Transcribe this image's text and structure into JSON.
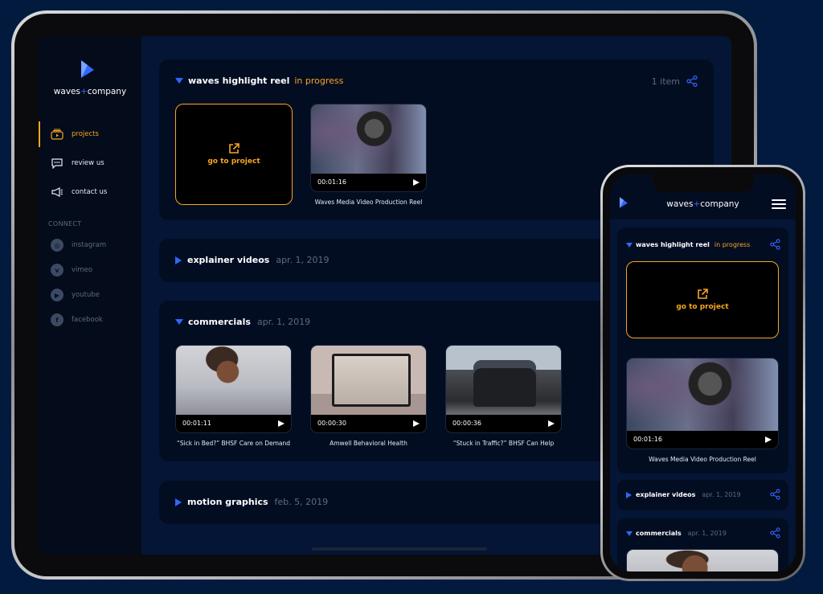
{
  "brand": {
    "name_left": "waves",
    "plus": "+",
    "name_right": "company"
  },
  "colors": {
    "accent": "#f5a623",
    "blue": "#2f67ff",
    "bg": "#031a3f",
    "panel": "#030d22"
  },
  "tablet": {
    "nav": [
      {
        "label": "projects",
        "icon": "projects-icon",
        "active": true
      },
      {
        "label": "review us",
        "icon": "chat-icon",
        "active": false
      },
      {
        "label": "contact us",
        "icon": "megaphone-icon",
        "active": false
      }
    ],
    "connect_label": "CONNECT",
    "social": [
      {
        "label": "instagram",
        "icon": "instagram-icon",
        "glyph": "◎"
      },
      {
        "label": "vimeo",
        "icon": "vimeo-icon",
        "glyph": "v"
      },
      {
        "label": "youtube",
        "icon": "youtube-icon",
        "glyph": "▶"
      },
      {
        "label": "facebook",
        "icon": "facebook-icon",
        "glyph": "f"
      }
    ],
    "sections": {
      "highlight": {
        "title": "waves highlight reel",
        "status": "in progress",
        "count": "1 item"
      },
      "explainer": {
        "title": "explainer videos",
        "date": "apr. 1, 2019"
      },
      "commercials": {
        "title": "commercials",
        "date": "apr. 1, 2019"
      },
      "motion": {
        "title": "motion graphics",
        "date": "feb. 5, 2019"
      }
    },
    "goto_label": "go to project",
    "highlight_video": {
      "time": "00:01:16",
      "title": "Waves Media Video Production Reel"
    },
    "commercial_videos": [
      {
        "time": "00:01:11",
        "title": "“Sick in Bed?” BHSF Care on Demand"
      },
      {
        "time": "00:00:30",
        "title": "Amwell Behavioral Health"
      },
      {
        "time": "00:00:36",
        "title": "“Stuck in Traffic?” BHSF Can Help"
      }
    ]
  },
  "phone": {
    "highlight": {
      "title": "waves highlight reel",
      "status": "in progress"
    },
    "goto_label": "go to project",
    "video": {
      "time": "00:01:16",
      "title": "Waves Media Video Production Reel"
    },
    "explainer": {
      "title": "explainer videos",
      "date": "apr. 1, 2019"
    },
    "commercials": {
      "title": "commercials",
      "date": "apr. 1, 2019"
    }
  }
}
